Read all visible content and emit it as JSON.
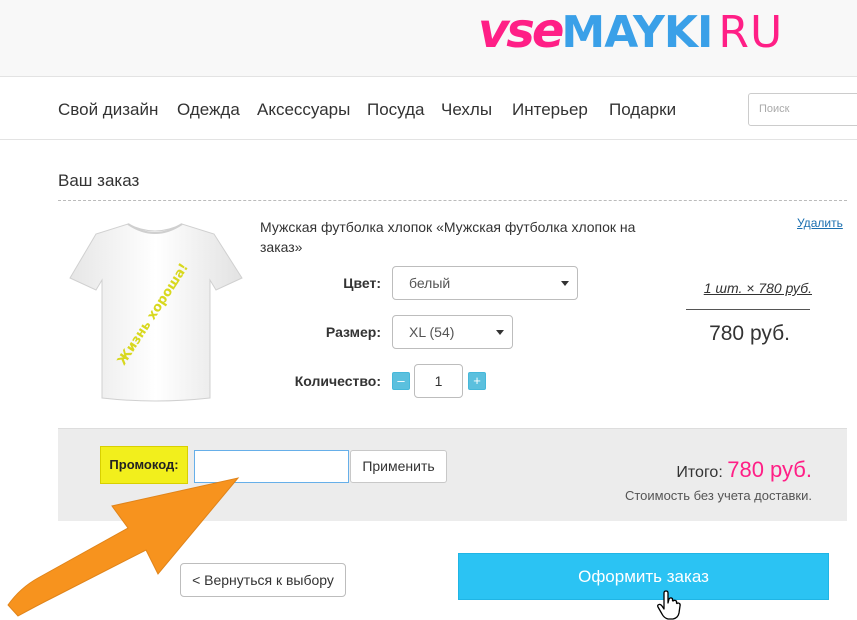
{
  "header": {
    "logo": {
      "part1": "vse",
      "part2": "MAYKI",
      "part3": "RU",
      "brand_pink": "#ff1f86",
      "brand_blue": "#3aa0e8"
    }
  },
  "nav": {
    "items": [
      {
        "label": "Свой дизайн"
      },
      {
        "label": "Одежда"
      },
      {
        "label": "Аксессуары"
      },
      {
        "label": "Посуда"
      },
      {
        "label": "Чехлы"
      },
      {
        "label": "Интерьер"
      },
      {
        "label": "Подарки"
      }
    ],
    "search_placeholder": "Поиск"
  },
  "order": {
    "title": "Ваш заказ",
    "item": {
      "name": "Мужская футболка хлопок «Мужская футболка хлопок на заказ»",
      "print_text": "Жизнь хороша!",
      "remove_label": "Удалить",
      "color_label": "Цвет:",
      "color_value": "белый",
      "size_label": "Размер:",
      "size_value": "XL (54)",
      "qty_label": "Количество:",
      "qty_minus": "–",
      "qty_value": "1",
      "qty_plus": "+",
      "unit_price": "1 шт. × 780 руб.",
      "line_total": "780 руб."
    }
  },
  "promo": {
    "label": "Промокод:",
    "input_value": "",
    "apply_label": "Применить"
  },
  "totals": {
    "label": "Итого:",
    "value": "780 руб.",
    "note": "Стоимость без учета доставки.",
    "accent": "#ff1f86"
  },
  "actions": {
    "back_label": "< Вернуться к выбору",
    "checkout_label": "Оформить заказ",
    "checkout_color": "#2bc3f3"
  },
  "annotation": {
    "arrow_color": "#f7931e",
    "icon": "pointer-hand-icon"
  }
}
